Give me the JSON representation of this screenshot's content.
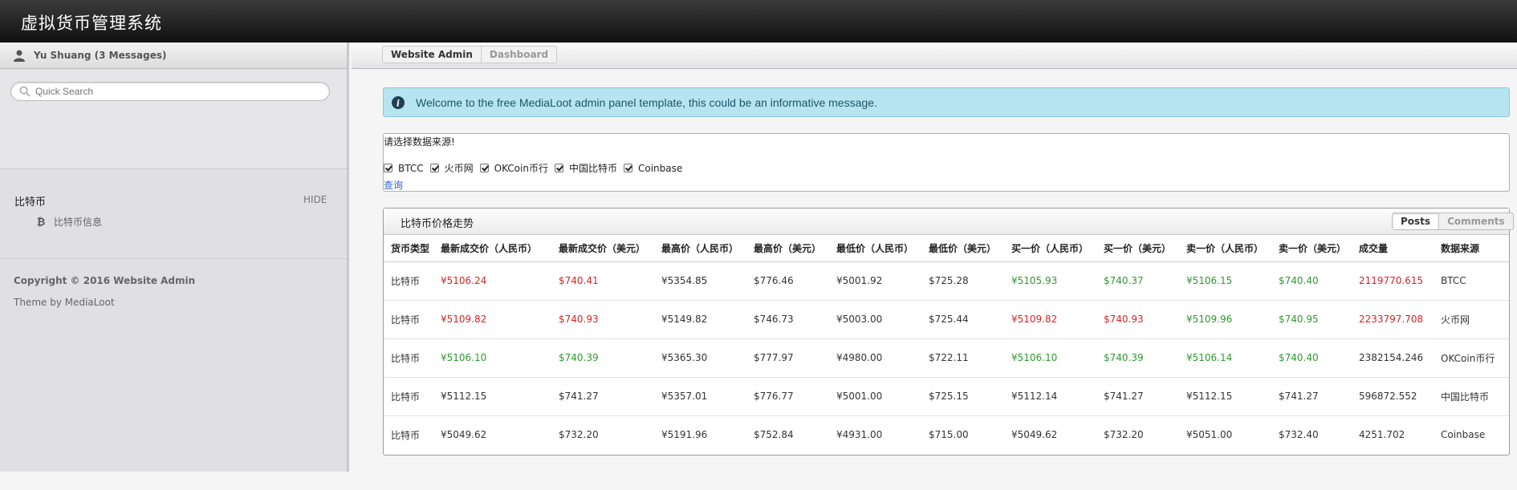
{
  "app": {
    "title": "虚拟货币管理系统"
  },
  "colors": {
    "up": "#e02020",
    "down": "#2e9a2e",
    "info_bg": "#b6e5f1",
    "link": "#3366cc"
  },
  "sidebar": {
    "user_label": "Yu Shuang (3 Messages)",
    "search": {
      "placeholder": "Quick Search",
      "value": ""
    },
    "section": {
      "heading": "比特币",
      "toggle_label": "HIDE",
      "items": [
        {
          "label": "比特币信息",
          "icon": "bitcoin-icon"
        }
      ]
    },
    "footer": {
      "copyright": "Copyright © 2016 Website Admin",
      "theme": "Theme by MediaLoot"
    }
  },
  "breadcrumbs": [
    {
      "label": "Website Admin",
      "current": true
    },
    {
      "label": "Dashboard",
      "current": false
    }
  ],
  "info": {
    "icon": "info-icon",
    "message": "Welcome to the free MediaLoot admin panel template, this could be an informative message."
  },
  "filter": {
    "prompt": "请选择数据来源!",
    "options": [
      {
        "label": "BTCC",
        "checked": true
      },
      {
        "label": "火币网",
        "checked": true
      },
      {
        "label": "OKCoin币行",
        "checked": true
      },
      {
        "label": "中国比特币",
        "checked": true
      },
      {
        "label": "Coinbase",
        "checked": true
      }
    ],
    "submit_label": "查询"
  },
  "panel": {
    "title": "比特币价格走势",
    "tabs": [
      {
        "label": "Posts",
        "active": true
      },
      {
        "label": "Comments",
        "active": false
      }
    ],
    "columns": [
      "货币类型",
      "最新成交价（人民币）",
      "最新成交价（美元）",
      "最高价（人民币）",
      "最高价（美元）",
      "最低价（人民币）",
      "最低价（美元）",
      "买一价（人民币）",
      "买一价（美元）",
      "卖一价（人民币）",
      "卖一价（美元）",
      "成交量",
      "数据来源"
    ],
    "rows": [
      {
        "cells": [
          "比特币",
          "¥5106.24",
          "$740.41",
          "¥5354.85",
          "$776.46",
          "¥5001.92",
          "$725.28",
          "¥5105.93",
          "$740.37",
          "¥5106.15",
          "$740.40",
          "2119770.615",
          "BTCC"
        ],
        "colors": [
          "",
          "up",
          "up",
          "",
          "",
          "",
          "",
          "down",
          "down",
          "down",
          "down",
          "up",
          ""
        ]
      },
      {
        "cells": [
          "比特币",
          "¥5109.82",
          "$740.93",
          "¥5149.82",
          "$746.73",
          "¥5003.00",
          "$725.44",
          "¥5109.82",
          "$740.93",
          "¥5109.96",
          "$740.95",
          "2233797.708",
          "火币网"
        ],
        "colors": [
          "",
          "up",
          "up",
          "",
          "",
          "",
          "",
          "up",
          "up",
          "down",
          "down",
          "up",
          ""
        ]
      },
      {
        "cells": [
          "比特币",
          "¥5106.10",
          "$740.39",
          "¥5365.30",
          "$777.97",
          "¥4980.00",
          "$722.11",
          "¥5106.10",
          "$740.39",
          "¥5106.14",
          "$740.40",
          "2382154.246",
          "OKCoin币行"
        ],
        "colors": [
          "",
          "down",
          "down",
          "",
          "",
          "",
          "",
          "down",
          "down",
          "down",
          "down",
          "",
          ""
        ]
      },
      {
        "cells": [
          "比特币",
          "¥5112.15",
          "$741.27",
          "¥5357.01",
          "$776.77",
          "¥5001.00",
          "$725.15",
          "¥5112.14",
          "$741.27",
          "¥5112.15",
          "$741.27",
          "596872.552",
          "中国比特币"
        ],
        "colors": [
          "",
          "",
          "",
          "",
          "",
          "",
          "",
          "",
          "",
          "",
          "",
          "",
          ""
        ]
      },
      {
        "cells": [
          "比特币",
          "¥5049.62",
          "$732.20",
          "¥5191.96",
          "$752.84",
          "¥4931.00",
          "$715.00",
          "¥5049.62",
          "$732.20",
          "¥5051.00",
          "$732.40",
          "4251.702",
          "Coinbase"
        ],
        "colors": [
          "",
          "",
          "",
          "",
          "",
          "",
          "",
          "",
          "",
          "",
          "",
          "",
          ""
        ]
      }
    ]
  }
}
